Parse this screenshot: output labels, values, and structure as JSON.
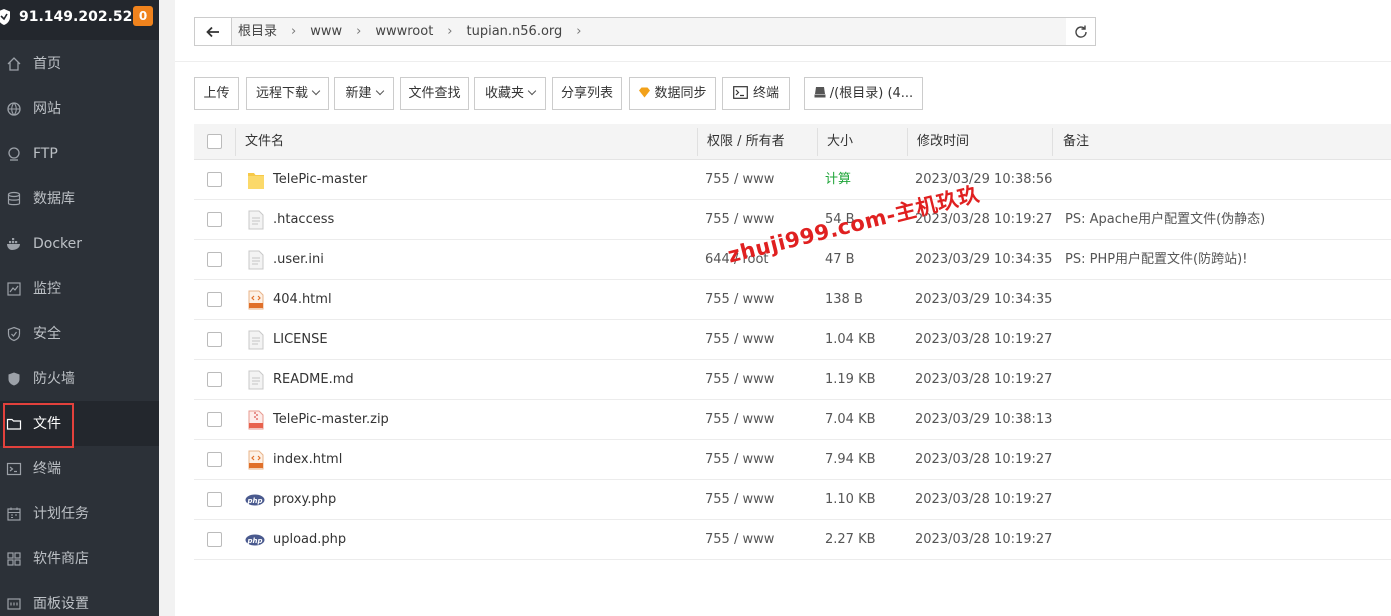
{
  "sidebar": {
    "server_ip": "91.149.202.52",
    "badge": "0",
    "items": [
      {
        "label": "首页",
        "icon": "home-icon"
      },
      {
        "label": "网站",
        "icon": "globe-icon"
      },
      {
        "label": "FTP",
        "icon": "ftp-icon"
      },
      {
        "label": "数据库",
        "icon": "database-icon"
      },
      {
        "label": "Docker",
        "icon": "docker-icon"
      },
      {
        "label": "监控",
        "icon": "monitor-icon"
      },
      {
        "label": "安全",
        "icon": "shield-check-icon"
      },
      {
        "label": "防火墙",
        "icon": "firewall-icon"
      },
      {
        "label": "文件",
        "icon": "folder-icon"
      },
      {
        "label": "终端",
        "icon": "terminal-icon"
      },
      {
        "label": "计划任务",
        "icon": "calendar-icon"
      },
      {
        "label": "软件商店",
        "icon": "apps-icon"
      },
      {
        "label": "面板设置",
        "icon": "settings-icon"
      }
    ],
    "active_item": "文件"
  },
  "breadcrumb": {
    "items": [
      "根目录",
      "www",
      "wwwroot",
      "tupian.n56.org"
    ]
  },
  "toolbar": {
    "upload": "上传",
    "remote_download": "远程下载",
    "new": "新建",
    "file_search": "文件查找",
    "favorites": "收藏夹",
    "share_list": "分享列表",
    "data_sync": "数据同步",
    "terminal": "终端",
    "disk": "/(根目录) (4..."
  },
  "table": {
    "headers": {
      "name": "文件名",
      "perm": "权限 / 所有者",
      "size": "大小",
      "mtime": "修改时间",
      "note": "备注"
    },
    "rows": [
      {
        "type": "folder",
        "name": "TelePic-master",
        "perm": "755 / www",
        "size": "计算",
        "mtime": "2023/03/29 10:38:56",
        "note": ""
      },
      {
        "type": "file",
        "name": ".htaccess",
        "perm": "755 / www",
        "size": "54 B",
        "mtime": "2023/03/28 10:19:27",
        "note": "PS: Apache用户配置文件(伪静态)"
      },
      {
        "type": "file",
        "name": ".user.ini",
        "perm": "644 / root",
        "size": "47 B",
        "mtime": "2023/03/29 10:34:35",
        "note": "PS: PHP用户配置文件(防跨站)!"
      },
      {
        "type": "html",
        "name": "404.html",
        "perm": "755 / www",
        "size": "138 B",
        "mtime": "2023/03/29 10:34:35",
        "note": ""
      },
      {
        "type": "file",
        "name": "LICENSE",
        "perm": "755 / www",
        "size": "1.04 KB",
        "mtime": "2023/03/28 10:19:27",
        "note": ""
      },
      {
        "type": "file",
        "name": "README.md",
        "perm": "755 / www",
        "size": "1.19 KB",
        "mtime": "2023/03/28 10:19:27",
        "note": ""
      },
      {
        "type": "zip",
        "name": "TelePic-master.zip",
        "perm": "755 / www",
        "size": "7.04 KB",
        "mtime": "2023/03/29 10:38:13",
        "note": ""
      },
      {
        "type": "html",
        "name": "index.html",
        "perm": "755 / www",
        "size": "7.94 KB",
        "mtime": "2023/03/28 10:19:27",
        "note": ""
      },
      {
        "type": "php",
        "name": "proxy.php",
        "perm": "755 / www",
        "size": "1.10 KB",
        "mtime": "2023/03/28 10:19:27",
        "note": ""
      },
      {
        "type": "php",
        "name": "upload.php",
        "perm": "755 / www",
        "size": "2.27 KB",
        "mtime": "2023/03/28 10:19:27",
        "note": ""
      }
    ]
  },
  "watermark": "zhuji999.com-主机玖玖",
  "colors": {
    "accent_green": "#20a53a",
    "sidebar_bg": "#2c3138",
    "badge": "#f0831d",
    "highlight": "#e3413c"
  }
}
